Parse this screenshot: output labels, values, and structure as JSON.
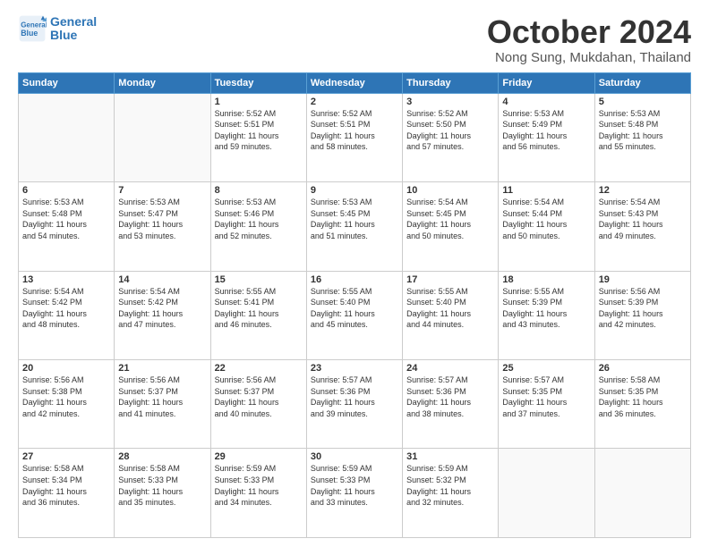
{
  "header": {
    "logo_line1": "General",
    "logo_line2": "Blue",
    "month": "October 2024",
    "location": "Nong Sung, Mukdahan, Thailand"
  },
  "weekdays": [
    "Sunday",
    "Monday",
    "Tuesday",
    "Wednesday",
    "Thursday",
    "Friday",
    "Saturday"
  ],
  "weeks": [
    [
      {
        "day": "",
        "info": ""
      },
      {
        "day": "",
        "info": ""
      },
      {
        "day": "1",
        "info": "Sunrise: 5:52 AM\nSunset: 5:51 PM\nDaylight: 11 hours\nand 59 minutes."
      },
      {
        "day": "2",
        "info": "Sunrise: 5:52 AM\nSunset: 5:51 PM\nDaylight: 11 hours\nand 58 minutes."
      },
      {
        "day": "3",
        "info": "Sunrise: 5:52 AM\nSunset: 5:50 PM\nDaylight: 11 hours\nand 57 minutes."
      },
      {
        "day": "4",
        "info": "Sunrise: 5:53 AM\nSunset: 5:49 PM\nDaylight: 11 hours\nand 56 minutes."
      },
      {
        "day": "5",
        "info": "Sunrise: 5:53 AM\nSunset: 5:48 PM\nDaylight: 11 hours\nand 55 minutes."
      }
    ],
    [
      {
        "day": "6",
        "info": "Sunrise: 5:53 AM\nSunset: 5:48 PM\nDaylight: 11 hours\nand 54 minutes."
      },
      {
        "day": "7",
        "info": "Sunrise: 5:53 AM\nSunset: 5:47 PM\nDaylight: 11 hours\nand 53 minutes."
      },
      {
        "day": "8",
        "info": "Sunrise: 5:53 AM\nSunset: 5:46 PM\nDaylight: 11 hours\nand 52 minutes."
      },
      {
        "day": "9",
        "info": "Sunrise: 5:53 AM\nSunset: 5:45 PM\nDaylight: 11 hours\nand 51 minutes."
      },
      {
        "day": "10",
        "info": "Sunrise: 5:54 AM\nSunset: 5:45 PM\nDaylight: 11 hours\nand 50 minutes."
      },
      {
        "day": "11",
        "info": "Sunrise: 5:54 AM\nSunset: 5:44 PM\nDaylight: 11 hours\nand 50 minutes."
      },
      {
        "day": "12",
        "info": "Sunrise: 5:54 AM\nSunset: 5:43 PM\nDaylight: 11 hours\nand 49 minutes."
      }
    ],
    [
      {
        "day": "13",
        "info": "Sunrise: 5:54 AM\nSunset: 5:42 PM\nDaylight: 11 hours\nand 48 minutes."
      },
      {
        "day": "14",
        "info": "Sunrise: 5:54 AM\nSunset: 5:42 PM\nDaylight: 11 hours\nand 47 minutes."
      },
      {
        "day": "15",
        "info": "Sunrise: 5:55 AM\nSunset: 5:41 PM\nDaylight: 11 hours\nand 46 minutes."
      },
      {
        "day": "16",
        "info": "Sunrise: 5:55 AM\nSunset: 5:40 PM\nDaylight: 11 hours\nand 45 minutes."
      },
      {
        "day": "17",
        "info": "Sunrise: 5:55 AM\nSunset: 5:40 PM\nDaylight: 11 hours\nand 44 minutes."
      },
      {
        "day": "18",
        "info": "Sunrise: 5:55 AM\nSunset: 5:39 PM\nDaylight: 11 hours\nand 43 minutes."
      },
      {
        "day": "19",
        "info": "Sunrise: 5:56 AM\nSunset: 5:39 PM\nDaylight: 11 hours\nand 42 minutes."
      }
    ],
    [
      {
        "day": "20",
        "info": "Sunrise: 5:56 AM\nSunset: 5:38 PM\nDaylight: 11 hours\nand 42 minutes."
      },
      {
        "day": "21",
        "info": "Sunrise: 5:56 AM\nSunset: 5:37 PM\nDaylight: 11 hours\nand 41 minutes."
      },
      {
        "day": "22",
        "info": "Sunrise: 5:56 AM\nSunset: 5:37 PM\nDaylight: 11 hours\nand 40 minutes."
      },
      {
        "day": "23",
        "info": "Sunrise: 5:57 AM\nSunset: 5:36 PM\nDaylight: 11 hours\nand 39 minutes."
      },
      {
        "day": "24",
        "info": "Sunrise: 5:57 AM\nSunset: 5:36 PM\nDaylight: 11 hours\nand 38 minutes."
      },
      {
        "day": "25",
        "info": "Sunrise: 5:57 AM\nSunset: 5:35 PM\nDaylight: 11 hours\nand 37 minutes."
      },
      {
        "day": "26",
        "info": "Sunrise: 5:58 AM\nSunset: 5:35 PM\nDaylight: 11 hours\nand 36 minutes."
      }
    ],
    [
      {
        "day": "27",
        "info": "Sunrise: 5:58 AM\nSunset: 5:34 PM\nDaylight: 11 hours\nand 36 minutes."
      },
      {
        "day": "28",
        "info": "Sunrise: 5:58 AM\nSunset: 5:33 PM\nDaylight: 11 hours\nand 35 minutes."
      },
      {
        "day": "29",
        "info": "Sunrise: 5:59 AM\nSunset: 5:33 PM\nDaylight: 11 hours\nand 34 minutes."
      },
      {
        "day": "30",
        "info": "Sunrise: 5:59 AM\nSunset: 5:33 PM\nDaylight: 11 hours\nand 33 minutes."
      },
      {
        "day": "31",
        "info": "Sunrise: 5:59 AM\nSunset: 5:32 PM\nDaylight: 11 hours\nand 32 minutes."
      },
      {
        "day": "",
        "info": ""
      },
      {
        "day": "",
        "info": ""
      }
    ]
  ]
}
